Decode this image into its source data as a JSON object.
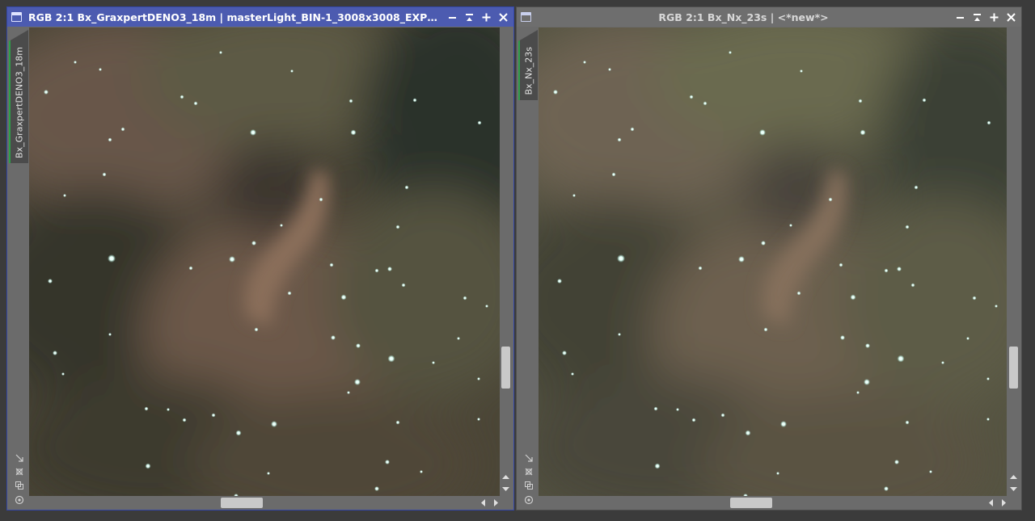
{
  "windows": [
    {
      "id": "win1",
      "title": "RGB 2:1 Bx_GraxpertDENO3_18m | masterLight_BIN-1_3008x3008_EXPO...",
      "tab_label": "Bx_GraxpertDENO3_18m",
      "active": true
    },
    {
      "id": "win2",
      "title": "RGB 2:1 Bx_Nx_23s | <*new*>",
      "tab_label": "Bx_Nx_23s",
      "active": false
    }
  ],
  "window_controls": [
    "minimize-icon",
    "shade-icon",
    "maximize-icon",
    "close-icon"
  ],
  "side_tools": [
    "fit-view-icon",
    "zoom-to-fit-icon",
    "clone-icon",
    "target-icon"
  ],
  "colors": {
    "active_title_bar": "#4c5bb0",
    "inactive_title_bar": "#6e6e6e",
    "workspace_bg": "#3b3b3b",
    "frame_bg": "#6b6b6b",
    "tab_accent": "#2ea04a"
  }
}
